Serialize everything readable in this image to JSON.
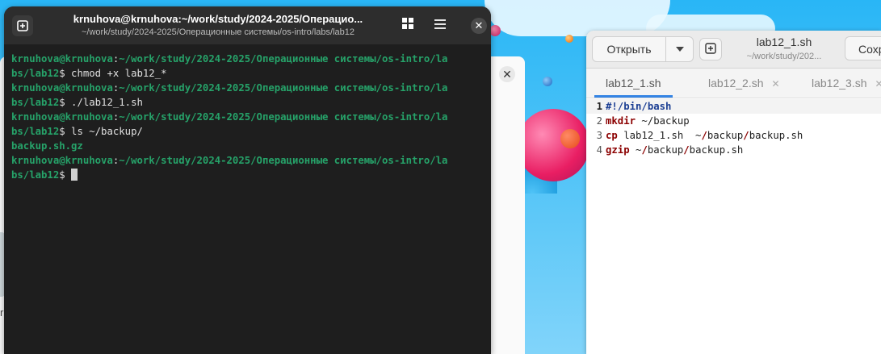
{
  "terminal": {
    "title": "krnuhova@krnuhova:~/work/study/2024-2025/Операцио...",
    "subtitle": "~/work/study/2024-2025/Операционные системы/os-intro/labs/lab12",
    "lines": [
      {
        "prompt": "krnuhova@krnuhova",
        "path": "~/work/study/2024-2025/Операционные системы/os-intro/la",
        "rest": ""
      },
      {
        "prompt": "",
        "path": "bs/lab12",
        "rest": "$ chmod +x lab12_*"
      },
      {
        "prompt": "krnuhova@krnuhova",
        "path": "~/work/study/2024-2025/Операционные системы/os-intro/la",
        "rest": ""
      },
      {
        "prompt": "",
        "path": "bs/lab12",
        "rest": "$ ./lab12_1.sh"
      },
      {
        "prompt": "krnuhova@krnuhova",
        "path": "~/work/study/2024-2025/Операционные системы/os-intro/la",
        "rest": ""
      },
      {
        "prompt": "",
        "path": "bs/lab12",
        "rest": "$ ls ~/backup/"
      },
      {
        "prompt": "",
        "path": "",
        "rest": "",
        "output": "backup.sh.gz"
      },
      {
        "prompt": "krnuhova@krnuhova",
        "path": "~/work/study/2024-2025/Операционные системы/os-intro/la",
        "rest": ""
      },
      {
        "prompt": "",
        "path": "bs/lab12",
        "rest": "$ ",
        "cursor": true
      }
    ]
  },
  "editor": {
    "open_label": "Открыть",
    "title": "lab12_1.sh",
    "subtitle": "~/work/study/202...",
    "save_label": "Сохр",
    "tabs": [
      {
        "label": "lab12_1.sh",
        "active": true
      },
      {
        "label": "lab12_2.sh",
        "active": false
      },
      {
        "label": "lab12_3.sh",
        "active": false
      }
    ],
    "line_numbers": [
      "1",
      "2",
      "3",
      "4"
    ],
    "code": [
      [
        {
          "t": "#!/bin/bash",
          "c": "sb"
        }
      ],
      [
        {
          "t": "mkdir",
          "c": "kw"
        },
        {
          "t": " ~/backup",
          "c": ""
        }
      ],
      [
        {
          "t": "cp",
          "c": "kw"
        },
        {
          "t": " lab12_1.sh  ~",
          "c": ""
        },
        {
          "t": "/",
          "c": "sl"
        },
        {
          "t": "backup",
          "c": ""
        },
        {
          "t": "/",
          "c": "sl"
        },
        {
          "t": "backup.sh",
          "c": ""
        }
      ],
      [
        {
          "t": "gzip",
          "c": "kw"
        },
        {
          "t": " ~",
          "c": ""
        },
        {
          "t": "/",
          "c": "sl"
        },
        {
          "t": "backup",
          "c": ""
        },
        {
          "t": "/",
          "c": "sl"
        },
        {
          "t": "backup.sh",
          "c": ""
        }
      ]
    ]
  },
  "background_window": {
    "close_glyph": "✕",
    "edge_char": "r"
  },
  "icons": {
    "new_tab": "new-tab-icon",
    "grid": "grid-icon",
    "menu": "hamburger-menu-icon",
    "close": "close-icon",
    "dropdown": "chevron-down-icon"
  }
}
